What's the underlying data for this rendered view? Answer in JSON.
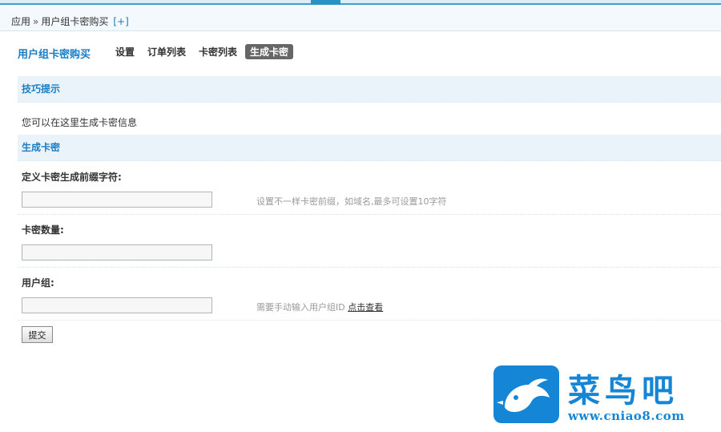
{
  "breadcrumb": {
    "root": "应用",
    "separator": "»",
    "current": "用户组卡密购买",
    "add_label": "[+]"
  },
  "module": {
    "title": "用户组卡密购买",
    "tabs": [
      {
        "label": "设置"
      },
      {
        "label": "订单列表"
      },
      {
        "label": "卡密列表"
      },
      {
        "label": "生成卡密",
        "active": true
      }
    ]
  },
  "tips": {
    "heading": "技巧提示",
    "text": "您可以在这里生成卡密信息"
  },
  "form": {
    "heading": "生成卡密",
    "prefix": {
      "label": "定义卡密生成前缀字符:",
      "value": "",
      "hint": "设置不一样卡密前缀，如域名,最多可设置10字符"
    },
    "quantity": {
      "label": "卡密数量:",
      "value": ""
    },
    "group": {
      "label": "用户组:",
      "value": "",
      "hint": "需要手动输入用户组ID",
      "hint_link": "点击查看"
    },
    "submit_label": "提交"
  },
  "watermark": {
    "name": "菜鸟吧",
    "url": "www.cniao8.com"
  },
  "colors": {
    "accent": "#1a7dc2",
    "panel_bg": "#e9f3f9",
    "brand": "#1586d6"
  }
}
